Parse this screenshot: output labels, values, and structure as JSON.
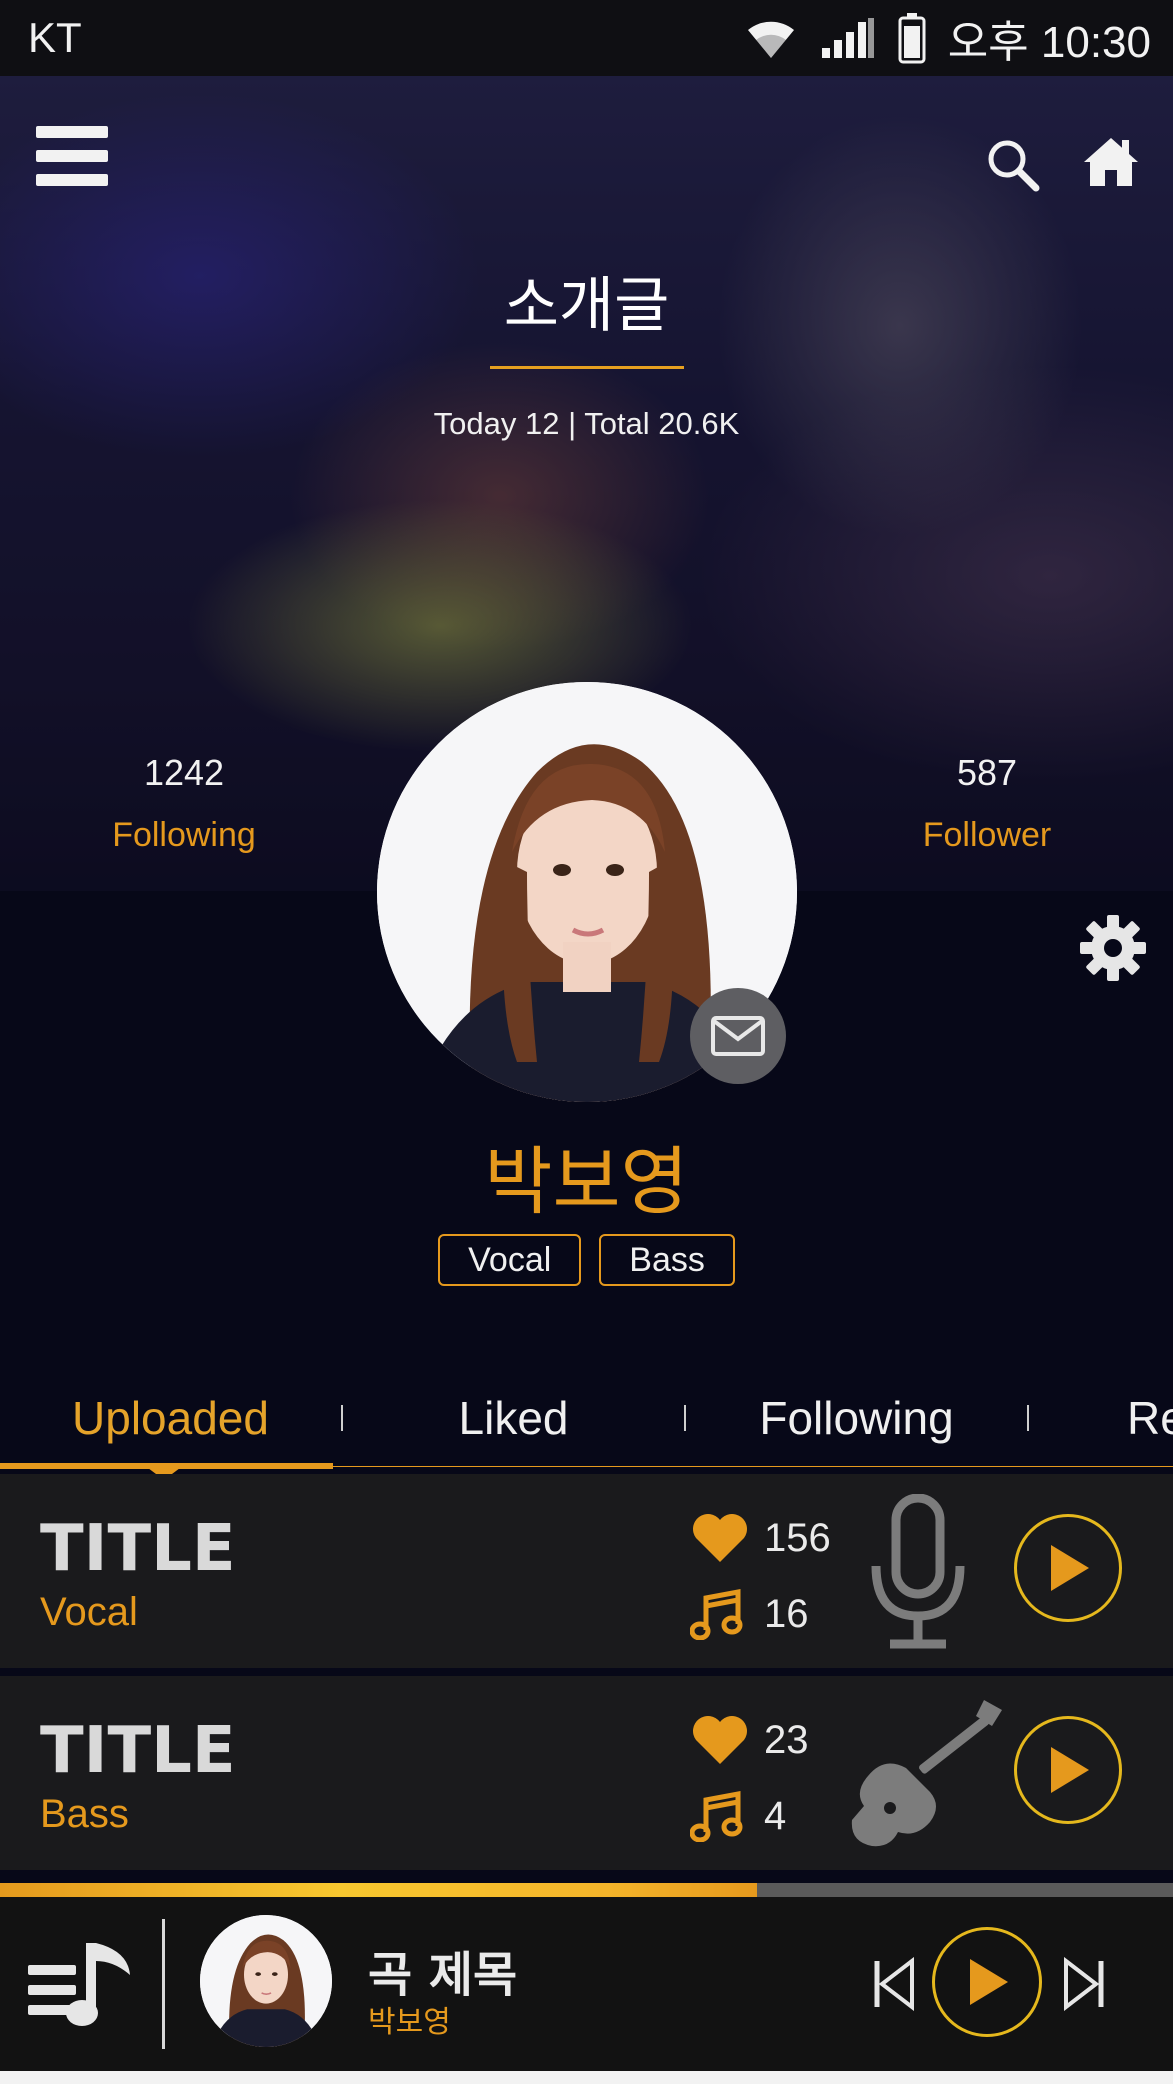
{
  "status_bar": {
    "carrier": "KT",
    "time": "오후 10:30"
  },
  "header": {
    "title": "소개글",
    "visits": "Today 12 | Total 20.6K"
  },
  "stats": {
    "following": {
      "count": "1242",
      "label": "Following"
    },
    "follower": {
      "count": "587",
      "label": "Follower"
    }
  },
  "profile": {
    "name": "박보영",
    "tags": [
      "Vocal",
      "Bass"
    ]
  },
  "tabs": [
    "Uploaded",
    "Liked",
    "Following",
    "Re"
  ],
  "active_tab": "Uploaded",
  "tracks": [
    {
      "title": "TITLE",
      "part": "Vocal",
      "likes": "156",
      "plays": "16",
      "instrument_icon": "microphone-icon"
    },
    {
      "title": "TITLE",
      "part": "Bass",
      "likes": "23",
      "plays": "4",
      "instrument_icon": "guitar-icon"
    }
  ],
  "player": {
    "song": "곡 제목",
    "artist": "박보영",
    "progress": 0.645
  },
  "colors": {
    "accent": "#e5991d",
    "play_ring": "#e5b81d",
    "background": "#070818",
    "row": "#1a1a1c"
  }
}
